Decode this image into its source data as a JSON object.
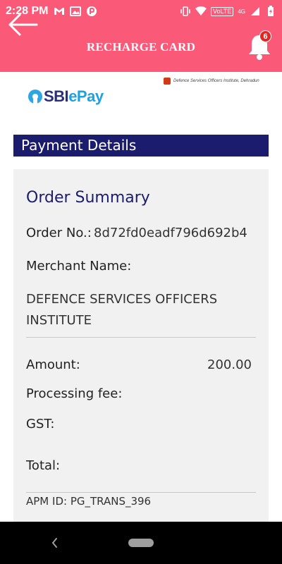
{
  "status_bar": {
    "time": "2:28 PM",
    "network_label": "VoLTE",
    "network_type": "4G",
    "battery_icon": "battery-charging-icon"
  },
  "app_bar": {
    "title": "RECHARGE CARD",
    "notification_count": "6",
    "back_icon": "arrow-left-icon",
    "bell_icon": "bell-icon"
  },
  "branding": {
    "logo_text_sbi": "SBI",
    "logo_text_epay": "ePay",
    "merchant_mini": "Defence Services Officers Institute, Dehradun"
  },
  "payment": {
    "header": "Payment Details",
    "order_summary_title": "Order Summary",
    "order_no_label": "Order No.:",
    "order_no_value": "8d72fd0eadf796d692b4",
    "merchant_label": "Merchant Name:",
    "merchant_value": "DEFENCE SERVICES OFFICERS INSTITUTE",
    "amount_label": "Amount:",
    "amount_value": "200.00",
    "processing_fee_label": "Processing fee:",
    "gst_label": "GST:",
    "total_label": "Total:",
    "apm_id": "APM ID: PG_TRANS_396"
  },
  "colors": {
    "app_bar": "#fa5a78",
    "header_bg": "#1b1c6e",
    "card_bg": "#f1f1f1",
    "badge": "#e52424"
  }
}
